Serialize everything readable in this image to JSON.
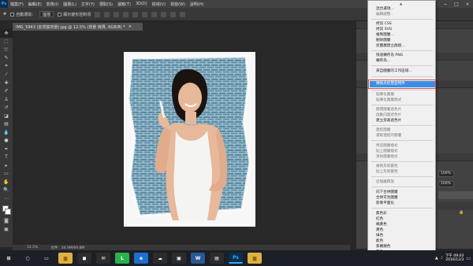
{
  "menubar": {
    "logo": "Ps",
    "items": [
      "檔案(F)",
      "編輯(E)",
      "影像(I)",
      "圖層(L)",
      "文字(Y)",
      "選取(S)",
      "濾鏡(T)",
      "3D(D)",
      "檢視(V)",
      "視窗(W)",
      "說明(H)"
    ],
    "controls": [
      "−",
      "□",
      "×"
    ]
  },
  "options": {
    "auto_select_label": "自動選取：",
    "auto_select_value": "圖層",
    "transform_controls_label": "顯示變形控制項"
  },
  "document_tab": {
    "title": "IMG_5943 (去背換背景).jpg @ 12.5% (背景 拷貝, RGB/8) *",
    "close": "×"
  },
  "status": {
    "zoom": "12.5%",
    "doc_size": "文件：34.9M/69.8M"
  },
  "panels": {
    "zoom_a": "100%",
    "zoom_b": "100%"
  },
  "context_menu": {
    "items": [
      {
        "label": "混合選項...",
        "disabled": false
      },
      {
        "label": "編輯調整...",
        "disabled": true
      },
      {
        "label": "拷貝 CSS",
        "disabled": false
      },
      {
        "label": "拷貝 SVG",
        "disabled": false
      },
      {
        "label": "複製圖層...",
        "disabled": false
      },
      {
        "label": "刪除圖層",
        "disabled": false
      },
      {
        "label": "從圖層建立群組...",
        "disabled": false
      },
      {
        "label": "快速轉存為 PNG",
        "disabled": false
      },
      {
        "label": "轉存為...",
        "disabled": false
      },
      {
        "label": "來自圖層的工作區域...",
        "disabled": false
      },
      {
        "label": "轉換為智慧型物件",
        "disabled": false,
        "highlighted": true
      },
      {
        "label": "點陣化圖層",
        "disabled": true
      },
      {
        "label": "點陣化圖層樣式",
        "disabled": true
      },
      {
        "label": "關閉圖層遮色片",
        "disabled": true
      },
      {
        "label": "啟動向量遮色片",
        "disabled": true
      },
      {
        "label": "建立剪裁遮色片",
        "disabled": false
      },
      {
        "label": "連結圖層",
        "disabled": true
      },
      {
        "label": "選取連結的圖層",
        "disabled": true
      },
      {
        "label": "拷貝圖層樣式",
        "disabled": true
      },
      {
        "label": "貼上圖層樣式",
        "disabled": true
      },
      {
        "label": "清除圖層樣式",
        "disabled": true
      },
      {
        "label": "複製形狀屬性",
        "disabled": true
      },
      {
        "label": "貼上形狀屬性",
        "disabled": true
      },
      {
        "label": "從隔離釋放",
        "disabled": true
      },
      {
        "label": "向下合併圖層",
        "disabled": false
      },
      {
        "label": "合併可見圖層",
        "disabled": false
      },
      {
        "label": "影像平面化",
        "disabled": false
      },
      {
        "label": "無色彩",
        "disabled": false
      },
      {
        "label": "紅色",
        "disabled": false
      },
      {
        "label": "橘黃色",
        "disabled": false
      },
      {
        "label": "黃色",
        "disabled": false
      },
      {
        "label": "綠色",
        "disabled": false
      },
      {
        "label": "藍色",
        "disabled": false
      },
      {
        "label": "紫羅蘭色",
        "disabled": false
      },
      {
        "label": "灰色",
        "disabled": false
      }
    ],
    "highlight_color": "#3a8ee6"
  },
  "taskbar": {
    "apps": [
      {
        "icon": "windows-start-icon",
        "label": "⊞",
        "color": "#1c1f26"
      },
      {
        "icon": "search-icon",
        "label": "○",
        "color": "#1c1f26"
      },
      {
        "icon": "task-view-icon",
        "label": "▭",
        "color": "#1c1f26"
      },
      {
        "icon": "file-explorer-icon",
        "label": "▆",
        "color": "#e0b040"
      },
      {
        "icon": "store-icon",
        "label": "◼",
        "color": "#2c2c2c"
      },
      {
        "icon": "mail-icon",
        "label": "✉",
        "color": "#2c2c2c"
      },
      {
        "icon": "line-icon",
        "label": "L",
        "color": "#2bb24c"
      },
      {
        "icon": "edge-icon",
        "label": "e",
        "color": "#1e6fd0"
      },
      {
        "icon": "onedrive-icon",
        "label": "☁",
        "color": "#2c2c2c"
      },
      {
        "icon": "photo-icon",
        "label": "▣",
        "color": "#2c2c2c"
      },
      {
        "icon": "word-icon",
        "label": "W",
        "color": "#2b5797"
      },
      {
        "icon": "document-icon",
        "label": "▤",
        "color": "#2c2c2c"
      },
      {
        "icon": "photoshop-icon",
        "label": "Ps",
        "color": "#0b2f4f"
      },
      {
        "icon": "folder-icon",
        "label": "▆",
        "color": "#e0b040"
      }
    ],
    "time": "下午 09:03",
    "date": "2016/12/3"
  },
  "colors": {
    "ps_accent": "#31a8ff",
    "brick_wall": "#5b8ea6"
  }
}
